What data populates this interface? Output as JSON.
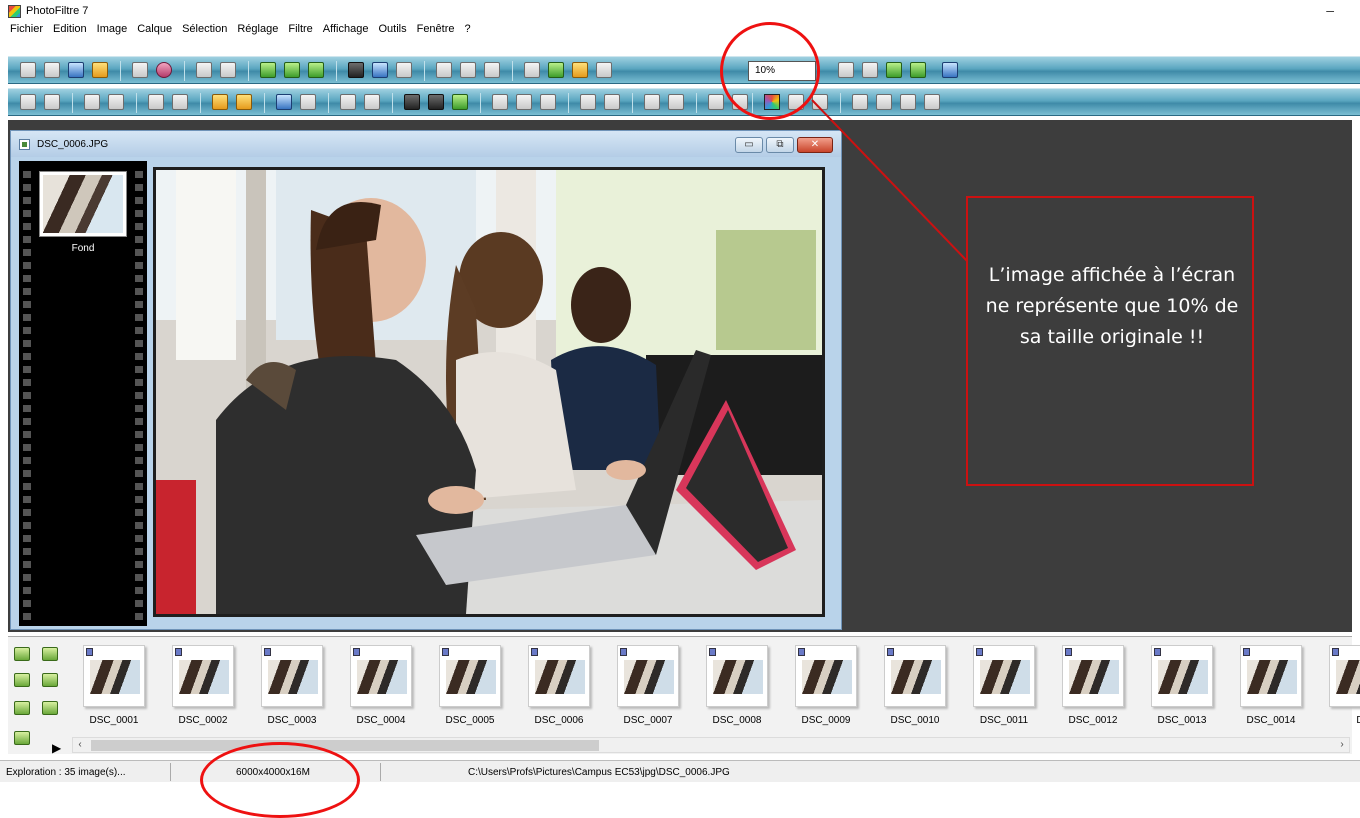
{
  "window": {
    "title": "PhotoFiltre 7"
  },
  "menu": [
    "Fichier",
    "Edition",
    "Image",
    "Calque",
    "Sélection",
    "Réglage",
    "Filtre",
    "Affichage",
    "Outils",
    "Fenêtre",
    "?"
  ],
  "toolbar": {
    "zoom_value": "10%"
  },
  "image_window": {
    "title": "DSC_0006.JPG",
    "layer_label": "Fond"
  },
  "thumbnails": [
    "DSC_0001",
    "DSC_0002",
    "DSC_0003",
    "DSC_0004",
    "DSC_0005",
    "DSC_0006",
    "DSC_0007",
    "DSC_0008",
    "DSC_0009",
    "DSC_0010",
    "DSC_0011",
    "DSC_0012",
    "DSC_0013",
    "DSC_0014",
    "D"
  ],
  "status": {
    "exploration": "Exploration : 35 image(s)...",
    "dimensions": "6000x4000x16M",
    "path": "C:\\Users\\Profs\\Pictures\\Campus EC53\\jpg\\DSC_0006.JPG"
  },
  "annotation": {
    "text": "L’image affichée à l’écran ne représente que 10% de sa taille originale !!"
  },
  "colors": {
    "toolbar": "#5aa6c0",
    "workspace": "#3d3d3d",
    "annotation_red": "#e11111"
  }
}
